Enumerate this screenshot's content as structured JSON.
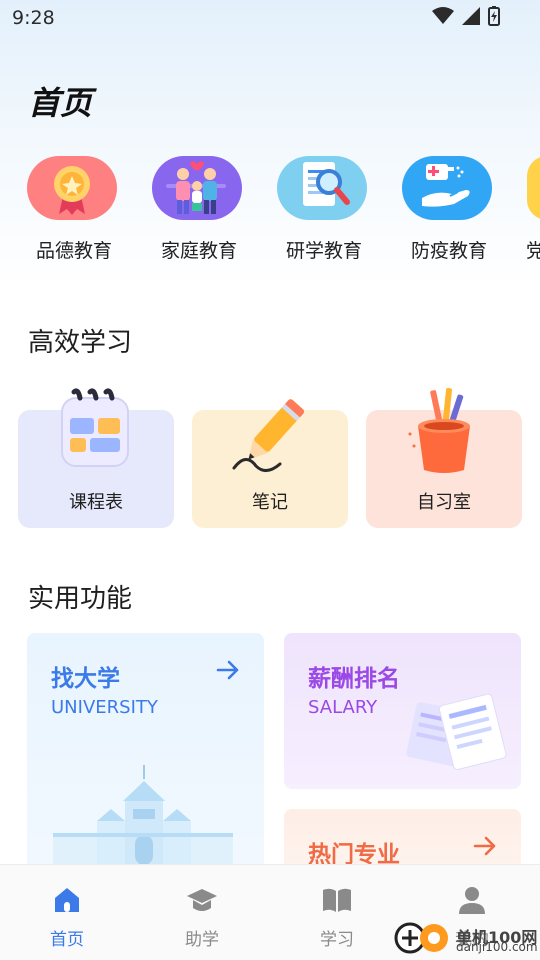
{
  "status": {
    "time": "9:28"
  },
  "title": "首页",
  "categories": [
    {
      "label": "品德教育",
      "color": "#ff7d7d",
      "icon": "medal-icon"
    },
    {
      "label": "家庭教育",
      "color": "#8a6cf2",
      "icon": "family-icon"
    },
    {
      "label": "研学教育",
      "color": "#7fd0f0",
      "icon": "magnifier-document-icon"
    },
    {
      "label": "防疫教育",
      "color": "#35a9f5",
      "icon": "sanitizer-hand-icon"
    },
    {
      "label": "党",
      "color": "#ffd24a",
      "icon": "partial-icon"
    }
  ],
  "study": {
    "title": "高效学习",
    "items": [
      {
        "label": "课程表",
        "bg": "#e6e8fb",
        "icon": "calendar-icon"
      },
      {
        "label": "笔记",
        "bg": "#fdefd4",
        "icon": "pencil-icon"
      },
      {
        "label": "自习室",
        "bg": "#fde3da",
        "icon": "pen-holder-icon"
      }
    ]
  },
  "features": {
    "title": "实用功能",
    "university": {
      "title": "找大学",
      "subtitle": "UNIVERSITY",
      "color": "#3b7ae8"
    },
    "salary": {
      "title": "薪酬排名",
      "subtitle": "SALARY",
      "color": "#9a48e6"
    },
    "major": {
      "title": "热门专业",
      "color": "#ef6a45"
    }
  },
  "tabs": [
    {
      "label": "首页",
      "icon": "home-icon",
      "active": true
    },
    {
      "label": "助学",
      "icon": "graduation-cap-icon",
      "active": false
    },
    {
      "label": "学习",
      "icon": "book-icon",
      "active": false
    },
    {
      "label": "我的",
      "icon": "person-icon",
      "active": false
    }
  ],
  "watermark": {
    "text": "单机100网",
    "url": "danji100.com"
  }
}
